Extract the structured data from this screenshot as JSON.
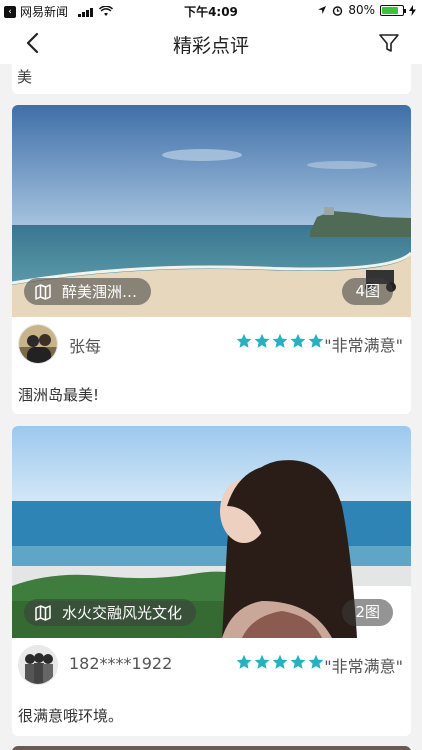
{
  "status_bar": {
    "back_app": "网易新闻",
    "time": "下午4:09",
    "battery_text": "80%",
    "battery_level": 0.8
  },
  "nav": {
    "title": "精彩点评"
  },
  "previous_card": {
    "text": "美"
  },
  "reviews": [
    {
      "tag": "醉美涠洲…",
      "photo_count": "4图",
      "username": "张每",
      "rating": 5,
      "satisfaction": "\"非常满意\"",
      "comment": "涠洲岛最美!"
    },
    {
      "tag": "水火交融风光文化",
      "photo_count": "2图",
      "username": "182****1922",
      "rating": 5,
      "satisfaction": "\"非常满意\"",
      "comment": "很满意哦环境。"
    }
  ],
  "colors": {
    "star": "#1fb3c3",
    "background": "#f2f2f2"
  }
}
